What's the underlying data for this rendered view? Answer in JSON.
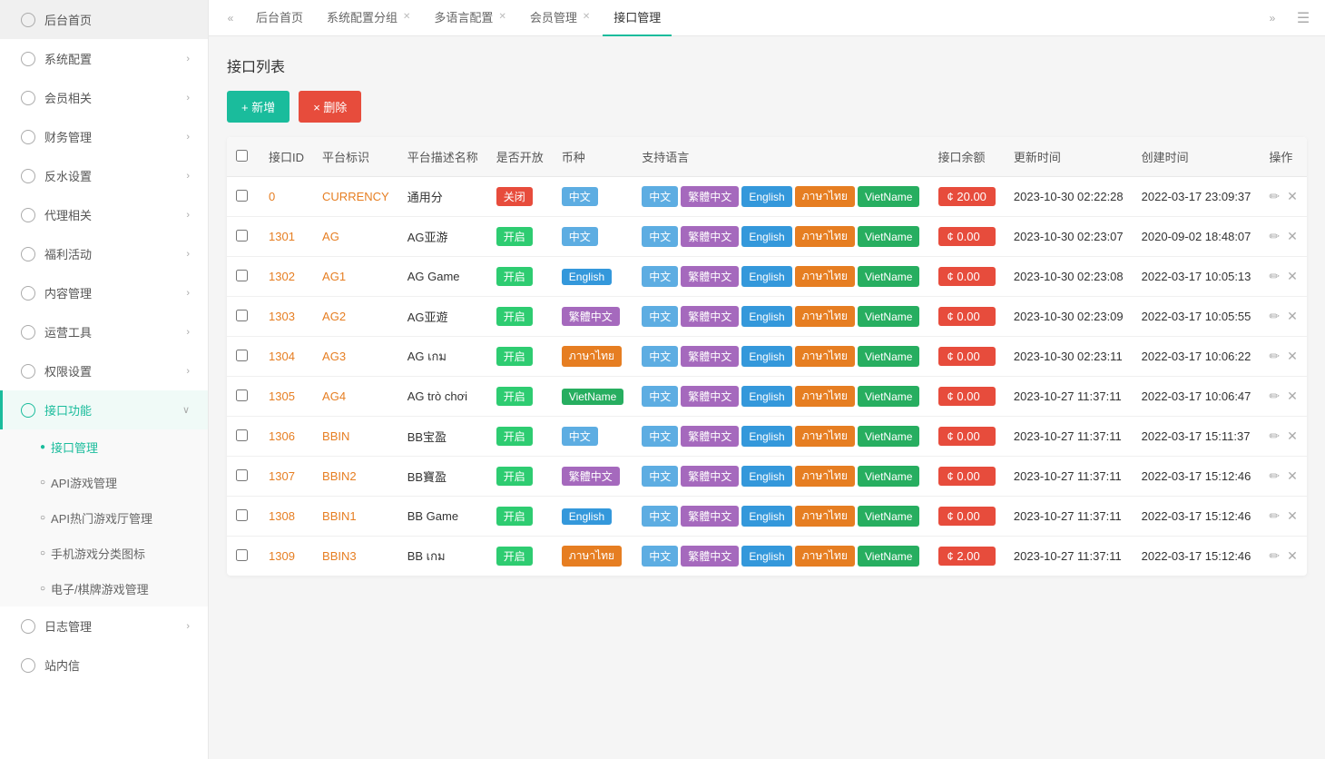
{
  "sidebar": {
    "logo_text": "后台首页",
    "items": [
      {
        "id": "home",
        "label": "后台首页",
        "hasArrow": false
      },
      {
        "id": "system",
        "label": "系统配置",
        "hasArrow": true
      },
      {
        "id": "member",
        "label": "会员相关",
        "hasArrow": true
      },
      {
        "id": "finance",
        "label": "财务管理",
        "hasArrow": true
      },
      {
        "id": "rebate",
        "label": "反水设置",
        "hasArrow": true
      },
      {
        "id": "agent",
        "label": "代理相关",
        "hasArrow": true
      },
      {
        "id": "welfare",
        "label": "福利活动",
        "hasArrow": true
      },
      {
        "id": "content",
        "label": "内容管理",
        "hasArrow": true
      },
      {
        "id": "ops",
        "label": "运营工具",
        "hasArrow": true
      },
      {
        "id": "permission",
        "label": "权限设置",
        "hasArrow": true
      },
      {
        "id": "interface",
        "label": "接口功能",
        "hasArrow": true,
        "active": true
      }
    ],
    "submenu": [
      {
        "id": "interface-mgmt",
        "label": "接口管理",
        "active": true
      },
      {
        "id": "api-game",
        "label": "API游戏管理"
      },
      {
        "id": "api-hot",
        "label": "API热门游戏厅管理"
      },
      {
        "id": "mobile-game",
        "label": "手机游戏分类图标"
      },
      {
        "id": "elec-game",
        "label": "电子/棋牌游戏管理"
      }
    ],
    "bottom_items": [
      {
        "id": "log",
        "label": "日志管理",
        "hasArrow": true
      },
      {
        "id": "inbox",
        "label": "站内信",
        "hasArrow": false
      }
    ]
  },
  "tabs": [
    {
      "id": "home",
      "label": "后台首页",
      "closable": false
    },
    {
      "id": "sys-config",
      "label": "系统配置分组",
      "closable": true
    },
    {
      "id": "multilang",
      "label": "多语言配置",
      "closable": true
    },
    {
      "id": "member-mgmt",
      "label": "会员管理",
      "closable": true
    },
    {
      "id": "interface-mgmt",
      "label": "接口管理",
      "closable": false,
      "active": true
    }
  ],
  "page": {
    "title": "接口列表",
    "btn_add": "+ 新增",
    "btn_del": "× 删除"
  },
  "table": {
    "headers": [
      "",
      "接口ID",
      "平台标识",
      "平台描述名称",
      "是否开放",
      "币种",
      "支持语言",
      "接口余额",
      "更新时间",
      "创建时间",
      "操作"
    ],
    "rows": [
      {
        "id": "0",
        "platform": "CURRENCY",
        "desc": "通用分",
        "open": "关闭",
        "open_type": "closed",
        "currency": "中文",
        "currency_type": "zh",
        "langs": [
          "中文",
          "繁體中文",
          "English",
          "ภาษาไทย",
          "VietName"
        ],
        "balance": "¢ 20.00",
        "balance_nonzero": true,
        "update": "2023-10-30 02:22:28",
        "create": "2022-03-17 23:09:37"
      },
      {
        "id": "1301",
        "platform": "AG",
        "desc": "AG亚游",
        "open": "开启",
        "open_type": "open",
        "currency": "中文",
        "currency_type": "zh",
        "langs": [
          "中文",
          "繁體中文",
          "English",
          "ภาษาไทย",
          "VietName"
        ],
        "balance": "¢ 0.00",
        "balance_nonzero": false,
        "update": "2023-10-30 02:23:07",
        "create": "2020-09-02 18:48:07"
      },
      {
        "id": "1302",
        "platform": "AG1",
        "desc": "AG Game",
        "open": "开启",
        "open_type": "open",
        "currency": "English",
        "currency_type": "en",
        "langs": [
          "中文",
          "繁體中文",
          "English",
          "ภาษาไทย",
          "VietName"
        ],
        "balance": "¢ 0.00",
        "balance_nonzero": false,
        "update": "2023-10-30 02:23:08",
        "create": "2022-03-17 10:05:13"
      },
      {
        "id": "1303",
        "platform": "AG2",
        "desc": "AG亚遊",
        "open": "开启",
        "open_type": "open",
        "currency": "繁體中文",
        "currency_type": "trad",
        "langs": [
          "中文",
          "繁體中文",
          "English",
          "ภาษาไทย",
          "VietName"
        ],
        "balance": "¢ 0.00",
        "balance_nonzero": false,
        "update": "2023-10-30 02:23:09",
        "create": "2022-03-17 10:05:55"
      },
      {
        "id": "1304",
        "platform": "AG3",
        "desc": "AG เกม",
        "open": "开启",
        "open_type": "open",
        "currency": "ภาษาไทย",
        "currency_type": "thai",
        "langs": [
          "中文",
          "繁體中文",
          "English",
          "ภาษาไทย",
          "VietName"
        ],
        "balance": "¢ 0.00",
        "balance_nonzero": false,
        "update": "2023-10-30 02:23:11",
        "create": "2022-03-17 10:06:22"
      },
      {
        "id": "1305",
        "platform": "AG4",
        "desc": "AG trò chơi",
        "open": "开启",
        "open_type": "open",
        "currency": "VietName",
        "currency_type": "vn",
        "langs": [
          "中文",
          "繁體中文",
          "English",
          "ภาษาไทย",
          "VietName"
        ],
        "balance": "¢ 0.00",
        "balance_nonzero": false,
        "update": "2023-10-27 11:37:11",
        "create": "2022-03-17 10:06:47"
      },
      {
        "id": "1306",
        "platform": "BBIN",
        "desc": "BB宝盈",
        "open": "开启",
        "open_type": "open",
        "currency": "中文",
        "currency_type": "zh",
        "langs": [
          "中文",
          "繁體中文",
          "English",
          "ภาษาไทย",
          "VietName"
        ],
        "balance": "¢ 0.00",
        "balance_nonzero": false,
        "update": "2023-10-27 11:37:11",
        "create": "2022-03-17 15:11:37"
      },
      {
        "id": "1307",
        "platform": "BBIN2",
        "desc": "BB寶盈",
        "open": "开启",
        "open_type": "open",
        "currency": "繁體中文",
        "currency_type": "trad",
        "langs": [
          "中文",
          "繁體中文",
          "English",
          "ภาษาไทย",
          "VietName"
        ],
        "balance": "¢ 0.00",
        "balance_nonzero": false,
        "update": "2023-10-27 11:37:11",
        "create": "2022-03-17 15:12:46"
      },
      {
        "id": "1308",
        "platform": "BBIN1",
        "desc": "BB Game",
        "open": "开启",
        "open_type": "open",
        "currency": "English",
        "currency_type": "en",
        "langs": [
          "中文",
          "繁體中文",
          "English",
          "ภาษาไทย",
          "VietName"
        ],
        "balance": "¢ 0.00",
        "balance_nonzero": false,
        "update": "2023-10-27 11:37:11",
        "create": "2022-03-17 15:12:46"
      },
      {
        "id": "1309",
        "platform": "BBIN3",
        "desc": "BB เกม",
        "open": "开启",
        "open_type": "open",
        "currency": "ภาษาไทย",
        "currency_type": "thai",
        "langs": [
          "中文",
          "繁體中文",
          "English",
          "ภาษาไทย",
          "VietName"
        ],
        "balance": "¢ 2.00",
        "balance_nonzero": true,
        "update": "2023-10-27 11:37:11",
        "create": "2022-03-17 15:12:46"
      }
    ]
  }
}
